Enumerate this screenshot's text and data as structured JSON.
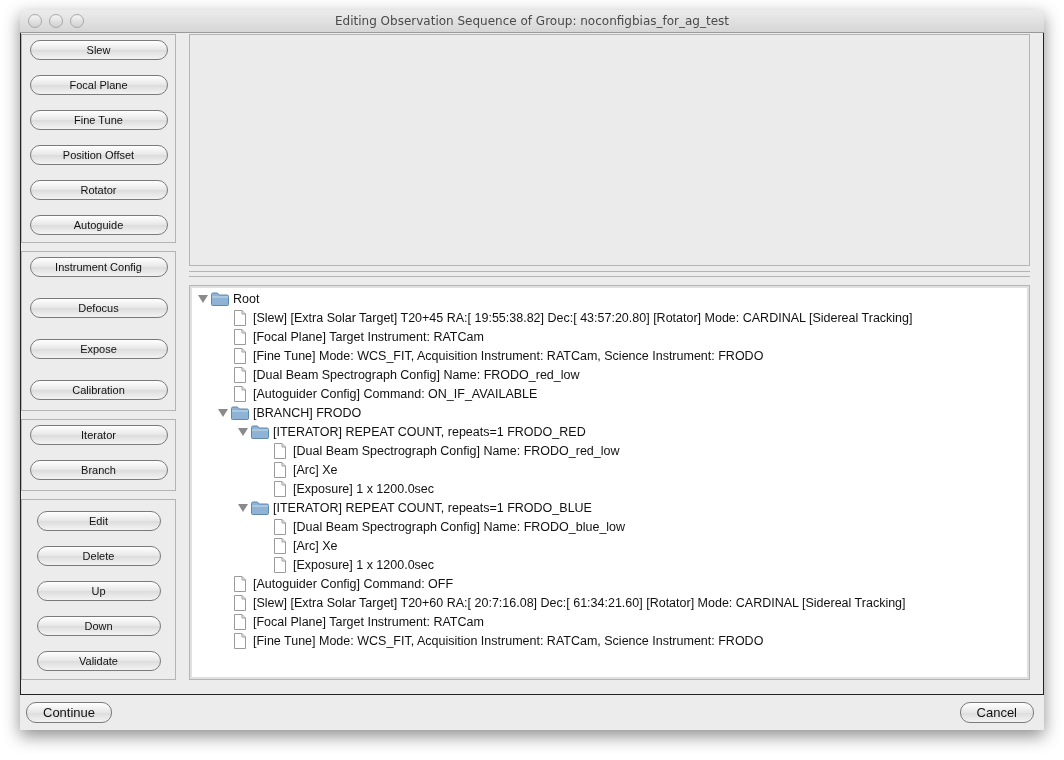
{
  "window": {
    "title": "Editing Observation Sequence of Group: noconfigbias_for_ag_test"
  },
  "button_groups": [
    {
      "kind": "wide",
      "buttons": [
        "Slew",
        "Focal Plane",
        "Fine Tune",
        "Position Offset",
        "Rotator",
        "Autoguide"
      ]
    },
    {
      "kind": "spaced",
      "buttons": [
        "Instrument Config",
        "Defocus",
        "Expose",
        "Calibration"
      ]
    },
    {
      "kind": "wide",
      "buttons": [
        "Iterator",
        "Branch"
      ]
    },
    {
      "kind": "narrow",
      "buttons": [
        "Edit",
        "Delete",
        "Up",
        "Down",
        "Validate"
      ]
    }
  ],
  "tree": [
    {
      "label": "Root",
      "kind": "folder",
      "expanded": true,
      "children": [
        {
          "label": "[Slew] [Extra Solar Target] T20+45 RA:[ 19:55:38.82] Dec:[ 43:57:20.80] [Rotator] Mode: CARDINAL [Sidereal Tracking]",
          "kind": "file"
        },
        {
          "label": "[Focal Plane] Target Instrument: RATCam",
          "kind": "file"
        },
        {
          "label": "[Fine Tune] Mode: WCS_FIT, Acquisition Instrument: RATCam, Science Instrument: FRODO",
          "kind": "file"
        },
        {
          "label": "[Dual Beam Spectrograph Config] Name: FRODO_red_low",
          "kind": "file"
        },
        {
          "label": "[Autoguider Config] Command: ON_IF_AVAILABLE",
          "kind": "file"
        },
        {
          "label": "[BRANCH] FRODO",
          "kind": "folder",
          "expanded": true,
          "children": [
            {
              "label": "[ITERATOR] REPEAT COUNT, repeats=1 FRODO_RED",
              "kind": "folder",
              "expanded": true,
              "children": [
                {
                  "label": "[Dual Beam Spectrograph Config] Name: FRODO_red_low",
                  "kind": "file"
                },
                {
                  "label": "[Arc] Xe",
                  "kind": "file"
                },
                {
                  "label": "[Exposure] 1 x 1200.0sec",
                  "kind": "file"
                }
              ]
            },
            {
              "label": "[ITERATOR] REPEAT COUNT, repeats=1 FRODO_BLUE",
              "kind": "folder",
              "expanded": true,
              "children": [
                {
                  "label": "[Dual Beam Spectrograph Config] Name: FRODO_blue_low",
                  "kind": "file"
                },
                {
                  "label": "[Arc] Xe",
                  "kind": "file"
                },
                {
                  "label": "[Exposure] 1 x 1200.0sec",
                  "kind": "file"
                }
              ]
            }
          ]
        },
        {
          "label": "[Autoguider Config] Command: OFF",
          "kind": "file"
        },
        {
          "label": "[Slew] [Extra Solar Target] T20+60 RA:[ 20:7:16.08] Dec:[ 61:34:21.60] [Rotator] Mode: CARDINAL [Sidereal Tracking]",
          "kind": "file"
        },
        {
          "label": "[Focal Plane] Target Instrument: RATCam",
          "kind": "file"
        },
        {
          "label": "[Fine Tune] Mode: WCS_FIT, Acquisition Instrument: RATCam, Science Instrument: FRODO",
          "kind": "file"
        }
      ]
    }
  ],
  "footer_buttons": [
    "Continue",
    "Cancel"
  ]
}
